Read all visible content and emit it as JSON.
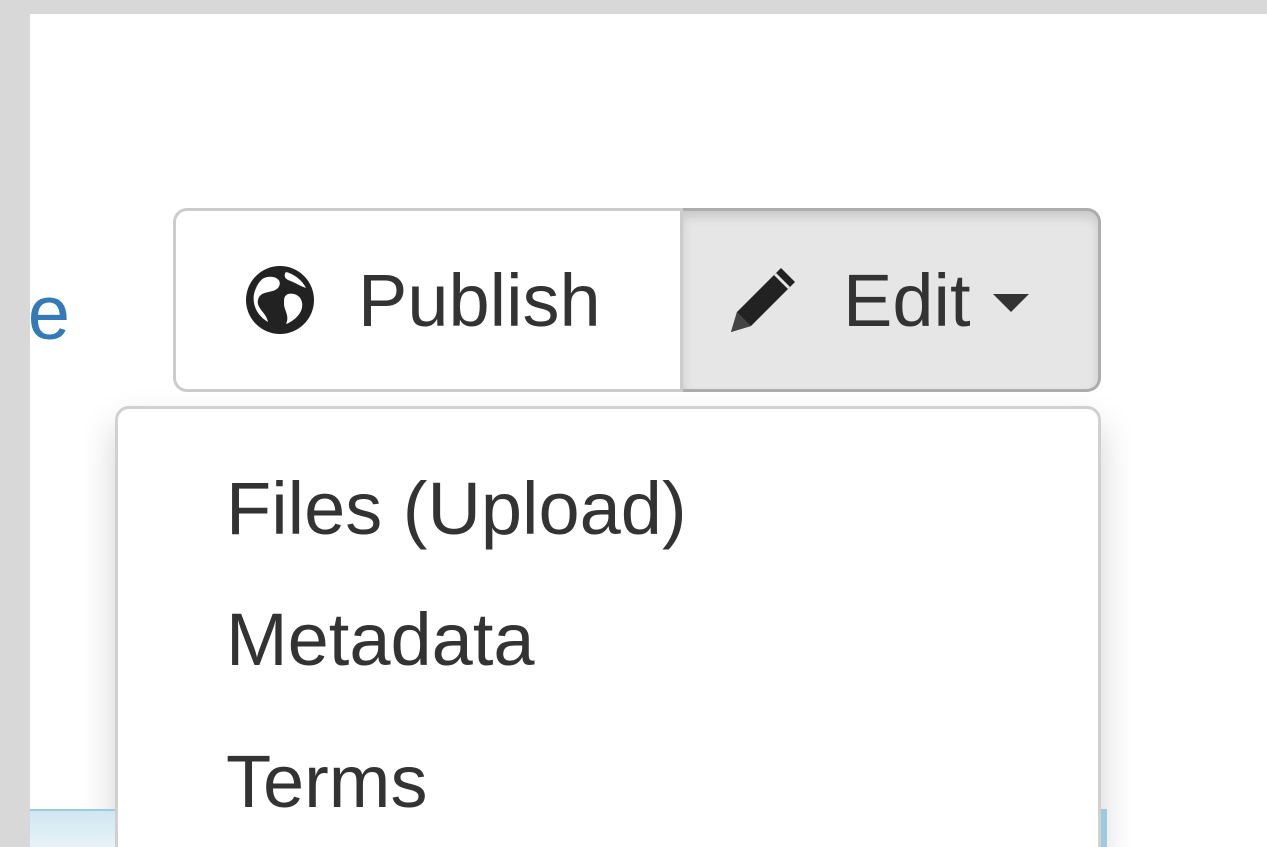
{
  "clipped_link": {
    "text": "e"
  },
  "toolbar": {
    "publish_label": "Publish",
    "publish_icon": "globe-icon",
    "edit_label": "Edit",
    "edit_icon": "pencil-icon"
  },
  "edit_menu": {
    "items": [
      {
        "label": "Files (Upload)"
      },
      {
        "label": "Metadata"
      },
      {
        "label": "Terms"
      }
    ]
  },
  "colors": {
    "link": "#337ab7",
    "text": "#333333",
    "border": "#cccccc",
    "active_bg": "#e6e6e6"
  }
}
